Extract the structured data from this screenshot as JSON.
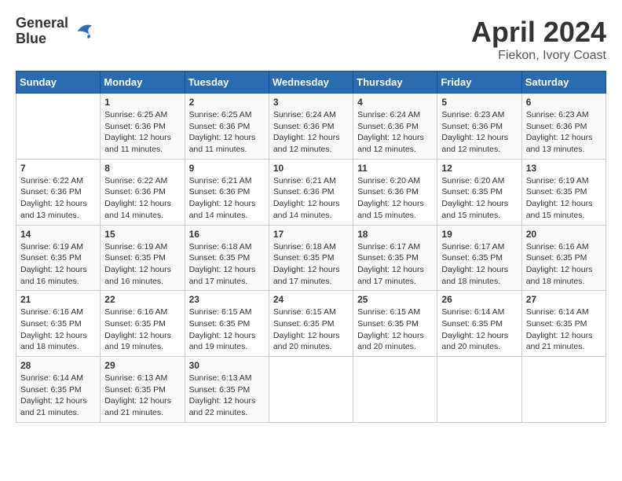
{
  "header": {
    "logo_line1": "General",
    "logo_line2": "Blue",
    "title": "April 2024",
    "subtitle": "Fiekon, Ivory Coast"
  },
  "weekdays": [
    "Sunday",
    "Monday",
    "Tuesday",
    "Wednesday",
    "Thursday",
    "Friday",
    "Saturday"
  ],
  "weeks": [
    [
      {
        "day": "",
        "info": ""
      },
      {
        "day": "1",
        "info": "Sunrise: 6:25 AM\nSunset: 6:36 PM\nDaylight: 12 hours\nand 11 minutes."
      },
      {
        "day": "2",
        "info": "Sunrise: 6:25 AM\nSunset: 6:36 PM\nDaylight: 12 hours\nand 11 minutes."
      },
      {
        "day": "3",
        "info": "Sunrise: 6:24 AM\nSunset: 6:36 PM\nDaylight: 12 hours\nand 12 minutes."
      },
      {
        "day": "4",
        "info": "Sunrise: 6:24 AM\nSunset: 6:36 PM\nDaylight: 12 hours\nand 12 minutes."
      },
      {
        "day": "5",
        "info": "Sunrise: 6:23 AM\nSunset: 6:36 PM\nDaylight: 12 hours\nand 12 minutes."
      },
      {
        "day": "6",
        "info": "Sunrise: 6:23 AM\nSunset: 6:36 PM\nDaylight: 12 hours\nand 13 minutes."
      }
    ],
    [
      {
        "day": "7",
        "info": "Sunrise: 6:22 AM\nSunset: 6:36 PM\nDaylight: 12 hours\nand 13 minutes."
      },
      {
        "day": "8",
        "info": "Sunrise: 6:22 AM\nSunset: 6:36 PM\nDaylight: 12 hours\nand 14 minutes."
      },
      {
        "day": "9",
        "info": "Sunrise: 6:21 AM\nSunset: 6:36 PM\nDaylight: 12 hours\nand 14 minutes."
      },
      {
        "day": "10",
        "info": "Sunrise: 6:21 AM\nSunset: 6:36 PM\nDaylight: 12 hours\nand 14 minutes."
      },
      {
        "day": "11",
        "info": "Sunrise: 6:20 AM\nSunset: 6:36 PM\nDaylight: 12 hours\nand 15 minutes."
      },
      {
        "day": "12",
        "info": "Sunrise: 6:20 AM\nSunset: 6:35 PM\nDaylight: 12 hours\nand 15 minutes."
      },
      {
        "day": "13",
        "info": "Sunrise: 6:19 AM\nSunset: 6:35 PM\nDaylight: 12 hours\nand 15 minutes."
      }
    ],
    [
      {
        "day": "14",
        "info": "Sunrise: 6:19 AM\nSunset: 6:35 PM\nDaylight: 12 hours\nand 16 minutes."
      },
      {
        "day": "15",
        "info": "Sunrise: 6:19 AM\nSunset: 6:35 PM\nDaylight: 12 hours\nand 16 minutes."
      },
      {
        "day": "16",
        "info": "Sunrise: 6:18 AM\nSunset: 6:35 PM\nDaylight: 12 hours\nand 17 minutes."
      },
      {
        "day": "17",
        "info": "Sunrise: 6:18 AM\nSunset: 6:35 PM\nDaylight: 12 hours\nand 17 minutes."
      },
      {
        "day": "18",
        "info": "Sunrise: 6:17 AM\nSunset: 6:35 PM\nDaylight: 12 hours\nand 17 minutes."
      },
      {
        "day": "19",
        "info": "Sunrise: 6:17 AM\nSunset: 6:35 PM\nDaylight: 12 hours\nand 18 minutes."
      },
      {
        "day": "20",
        "info": "Sunrise: 6:16 AM\nSunset: 6:35 PM\nDaylight: 12 hours\nand 18 minutes."
      }
    ],
    [
      {
        "day": "21",
        "info": "Sunrise: 6:16 AM\nSunset: 6:35 PM\nDaylight: 12 hours\nand 18 minutes."
      },
      {
        "day": "22",
        "info": "Sunrise: 6:16 AM\nSunset: 6:35 PM\nDaylight: 12 hours\nand 19 minutes."
      },
      {
        "day": "23",
        "info": "Sunrise: 6:15 AM\nSunset: 6:35 PM\nDaylight: 12 hours\nand 19 minutes."
      },
      {
        "day": "24",
        "info": "Sunrise: 6:15 AM\nSunset: 6:35 PM\nDaylight: 12 hours\nand 20 minutes."
      },
      {
        "day": "25",
        "info": "Sunrise: 6:15 AM\nSunset: 6:35 PM\nDaylight: 12 hours\nand 20 minutes."
      },
      {
        "day": "26",
        "info": "Sunrise: 6:14 AM\nSunset: 6:35 PM\nDaylight: 12 hours\nand 20 minutes."
      },
      {
        "day": "27",
        "info": "Sunrise: 6:14 AM\nSunset: 6:35 PM\nDaylight: 12 hours\nand 21 minutes."
      }
    ],
    [
      {
        "day": "28",
        "info": "Sunrise: 6:14 AM\nSunset: 6:35 PM\nDaylight: 12 hours\nand 21 minutes."
      },
      {
        "day": "29",
        "info": "Sunrise: 6:13 AM\nSunset: 6:35 PM\nDaylight: 12 hours\nand 21 minutes."
      },
      {
        "day": "30",
        "info": "Sunrise: 6:13 AM\nSunset: 6:35 PM\nDaylight: 12 hours\nand 22 minutes."
      },
      {
        "day": "",
        "info": ""
      },
      {
        "day": "",
        "info": ""
      },
      {
        "day": "",
        "info": ""
      },
      {
        "day": "",
        "info": ""
      }
    ]
  ]
}
